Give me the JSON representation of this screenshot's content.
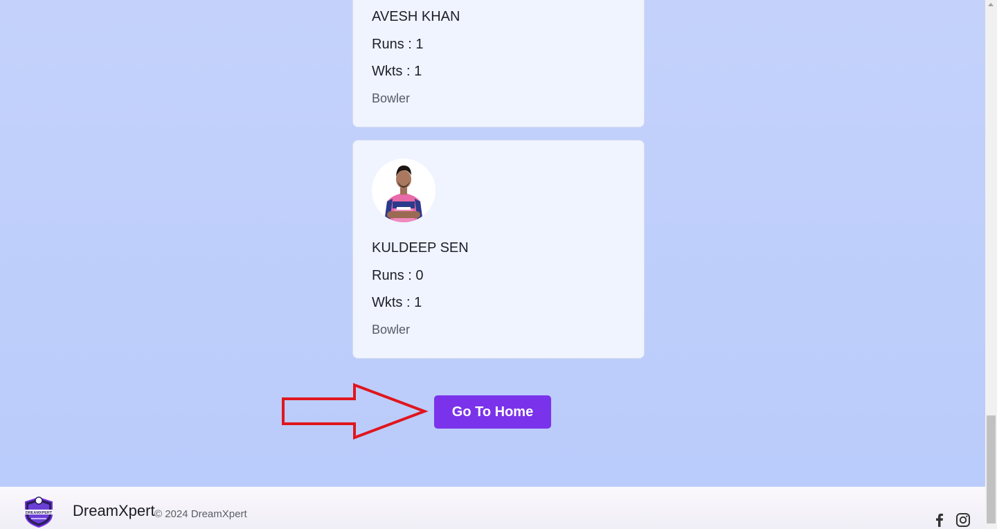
{
  "players": [
    {
      "name": "AVESH KHAN",
      "runs_label": "Runs : 1",
      "wkts_label": "Wkts : 1",
      "role": "Bowler"
    },
    {
      "name": "KULDEEP SEN",
      "runs_label": "Runs : 0",
      "wkts_label": "Wkts : 1",
      "role": "Bowler"
    }
  ],
  "home_button": {
    "label": "Go To Home"
  },
  "footer": {
    "brand": "DreamXpert",
    "logo_text": "DREAMXPERT",
    "copyright": "© 2024 DreamXpert",
    "social": [
      "facebook-icon",
      "instagram-icon"
    ]
  },
  "colors": {
    "accent": "#7a33ea",
    "arrow": "#e0161e",
    "card_bg": "#eff4fe"
  }
}
